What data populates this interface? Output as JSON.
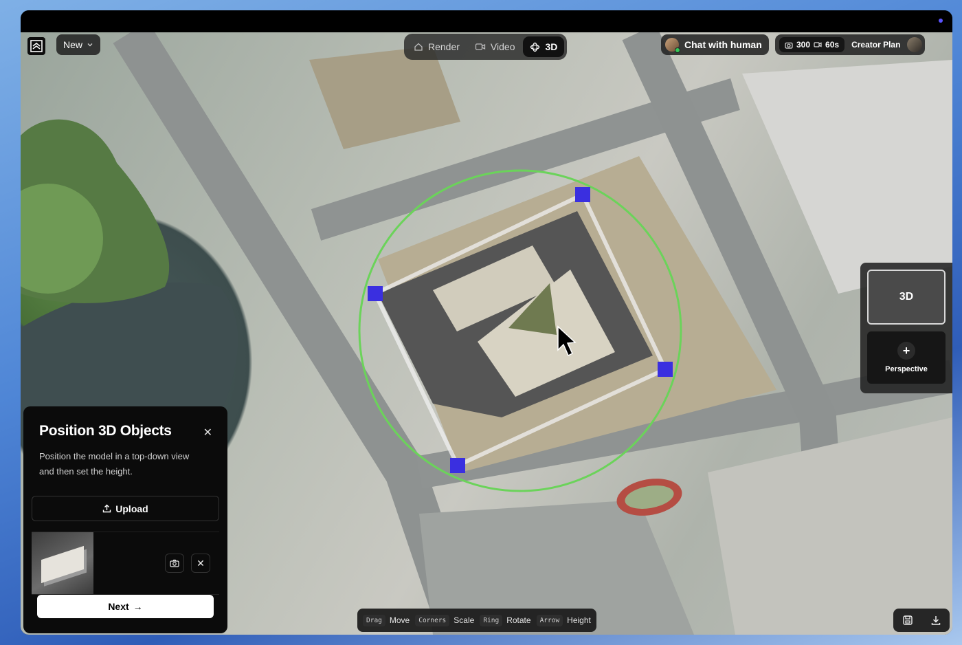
{
  "topbar": {
    "new_label": "New",
    "modes": [
      {
        "label": "Render",
        "icon": "home-icon",
        "active": false
      },
      {
        "label": "Video",
        "icon": "video-camera-icon",
        "active": false
      },
      {
        "label": "3D",
        "icon": "rotate-3d-icon",
        "active": true
      }
    ],
    "chat_label": "Chat with human",
    "credits": {
      "photos": "300",
      "video": "60s"
    },
    "plan_label": "Creator Plan"
  },
  "view_panel": {
    "current_view": "3D",
    "add_label": "Perspective"
  },
  "object_panel": {
    "title": "Position 3D Objects",
    "description": "Position the model in a top-down view and then set the height.",
    "upload_label": "Upload",
    "next_label": "Next"
  },
  "hints": [
    {
      "key": "Drag",
      "action": "Move"
    },
    {
      "key": "Corners",
      "action": "Scale"
    },
    {
      "key": "Ring",
      "action": "Rotate"
    },
    {
      "key": "Arrow",
      "action": "Height"
    }
  ],
  "colors": {
    "ring": "#6bd35a",
    "handle": "#3a2fe0",
    "accent": "#5b54ff"
  }
}
